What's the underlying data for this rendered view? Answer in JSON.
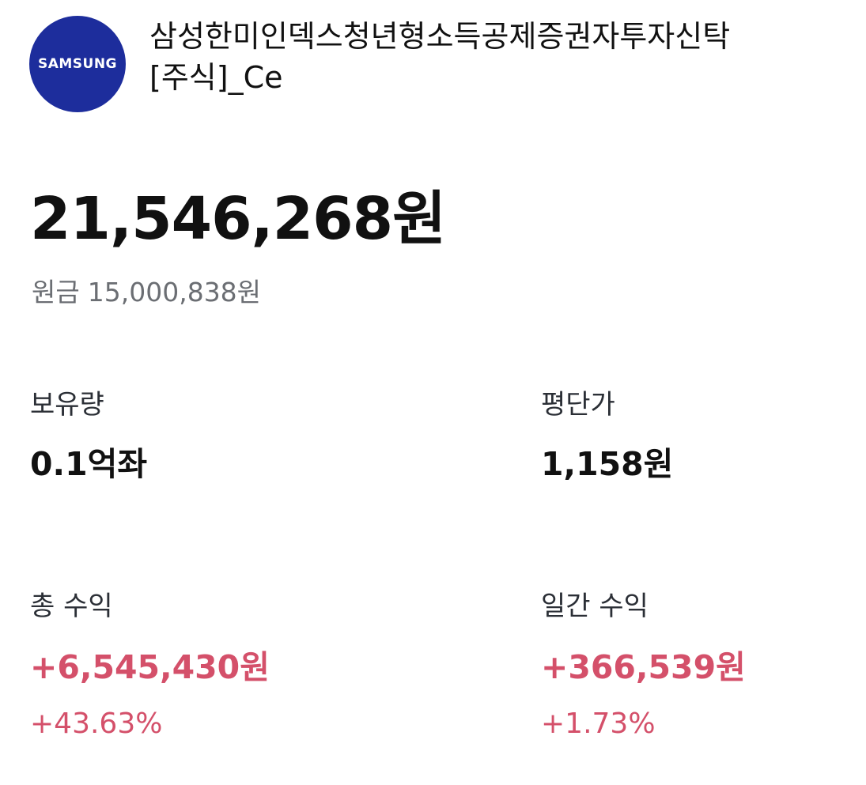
{
  "fund": {
    "logo_text": "SAMSUNG",
    "name": "삼성한미인덱스청년형소득공제증권자투자신탁[주식]_Ce"
  },
  "valuation": {
    "amount": "21,546,268원",
    "principal_label": "원금",
    "principal_value": "15,000,838원"
  },
  "holdings": {
    "quantity_label": "보유량",
    "quantity_value": "0.1억좌",
    "avg_price_label": "평단가",
    "avg_price_value": "1,158원"
  },
  "returns": {
    "total_label": "총 수익",
    "total_value": "+6,545,430원",
    "total_pct": "+43.63%",
    "daily_label": "일간 수익",
    "daily_value": "+366,539원",
    "daily_pct": "+1.73%"
  },
  "colors": {
    "logo_bg": "#1d2d9c",
    "positive": "#d4506a",
    "text_primary": "#111111",
    "text_secondary": "#6b6e73"
  }
}
